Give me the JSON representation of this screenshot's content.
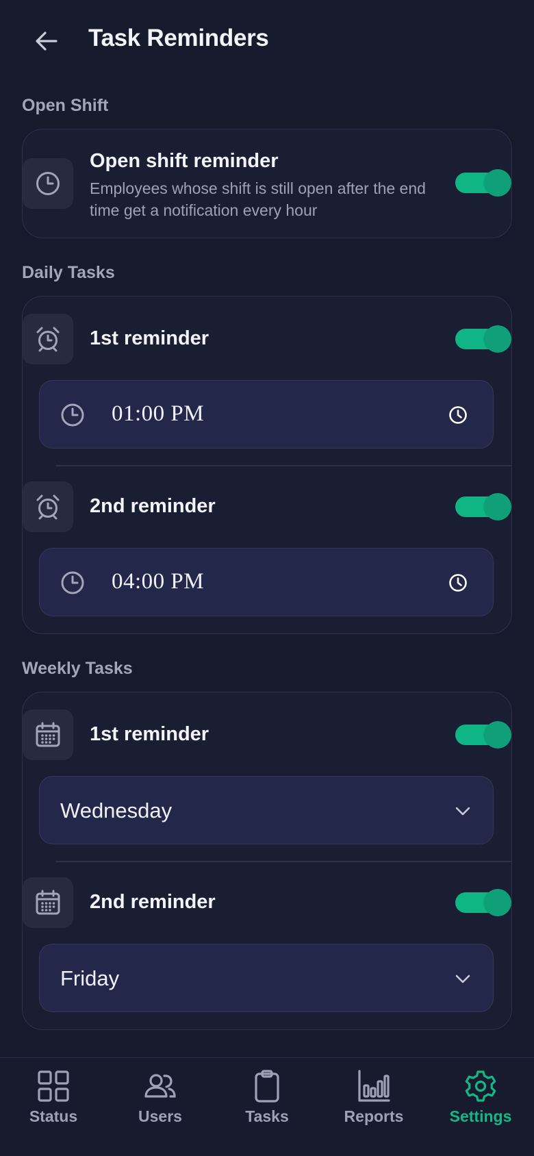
{
  "header": {
    "title": "Task Reminders"
  },
  "sections": {
    "open_shift": {
      "label": "Open Shift",
      "reminder": {
        "title": "Open shift reminder",
        "description": "Employees whose shift is still open after the end time get a notification every hour",
        "enabled": true
      }
    },
    "daily": {
      "label": "Daily Tasks",
      "reminders": [
        {
          "title": "1st reminder",
          "time": "01:00 PM",
          "enabled": true
        },
        {
          "title": "2nd reminder",
          "time": "04:00 PM",
          "enabled": true
        }
      ]
    },
    "weekly": {
      "label": "Weekly Tasks",
      "reminders": [
        {
          "title": "1st reminder",
          "day": "Wednesday",
          "enabled": true
        },
        {
          "title": "2nd reminder",
          "day": "Friday",
          "enabled": true
        }
      ]
    }
  },
  "bottom_nav": {
    "items": [
      {
        "label": "Status",
        "icon": "grid-icon",
        "active": false
      },
      {
        "label": "Users",
        "icon": "users-icon",
        "active": false
      },
      {
        "label": "Tasks",
        "icon": "clipboard-icon",
        "active": false
      },
      {
        "label": "Reports",
        "icon": "bar-chart-icon",
        "active": false
      },
      {
        "label": "Settings",
        "icon": "gear-icon",
        "active": true
      }
    ]
  },
  "colors": {
    "background": "#161a2c",
    "accent": "#13b886",
    "card_border": "#2d3150",
    "field_bg": "#23274a"
  }
}
